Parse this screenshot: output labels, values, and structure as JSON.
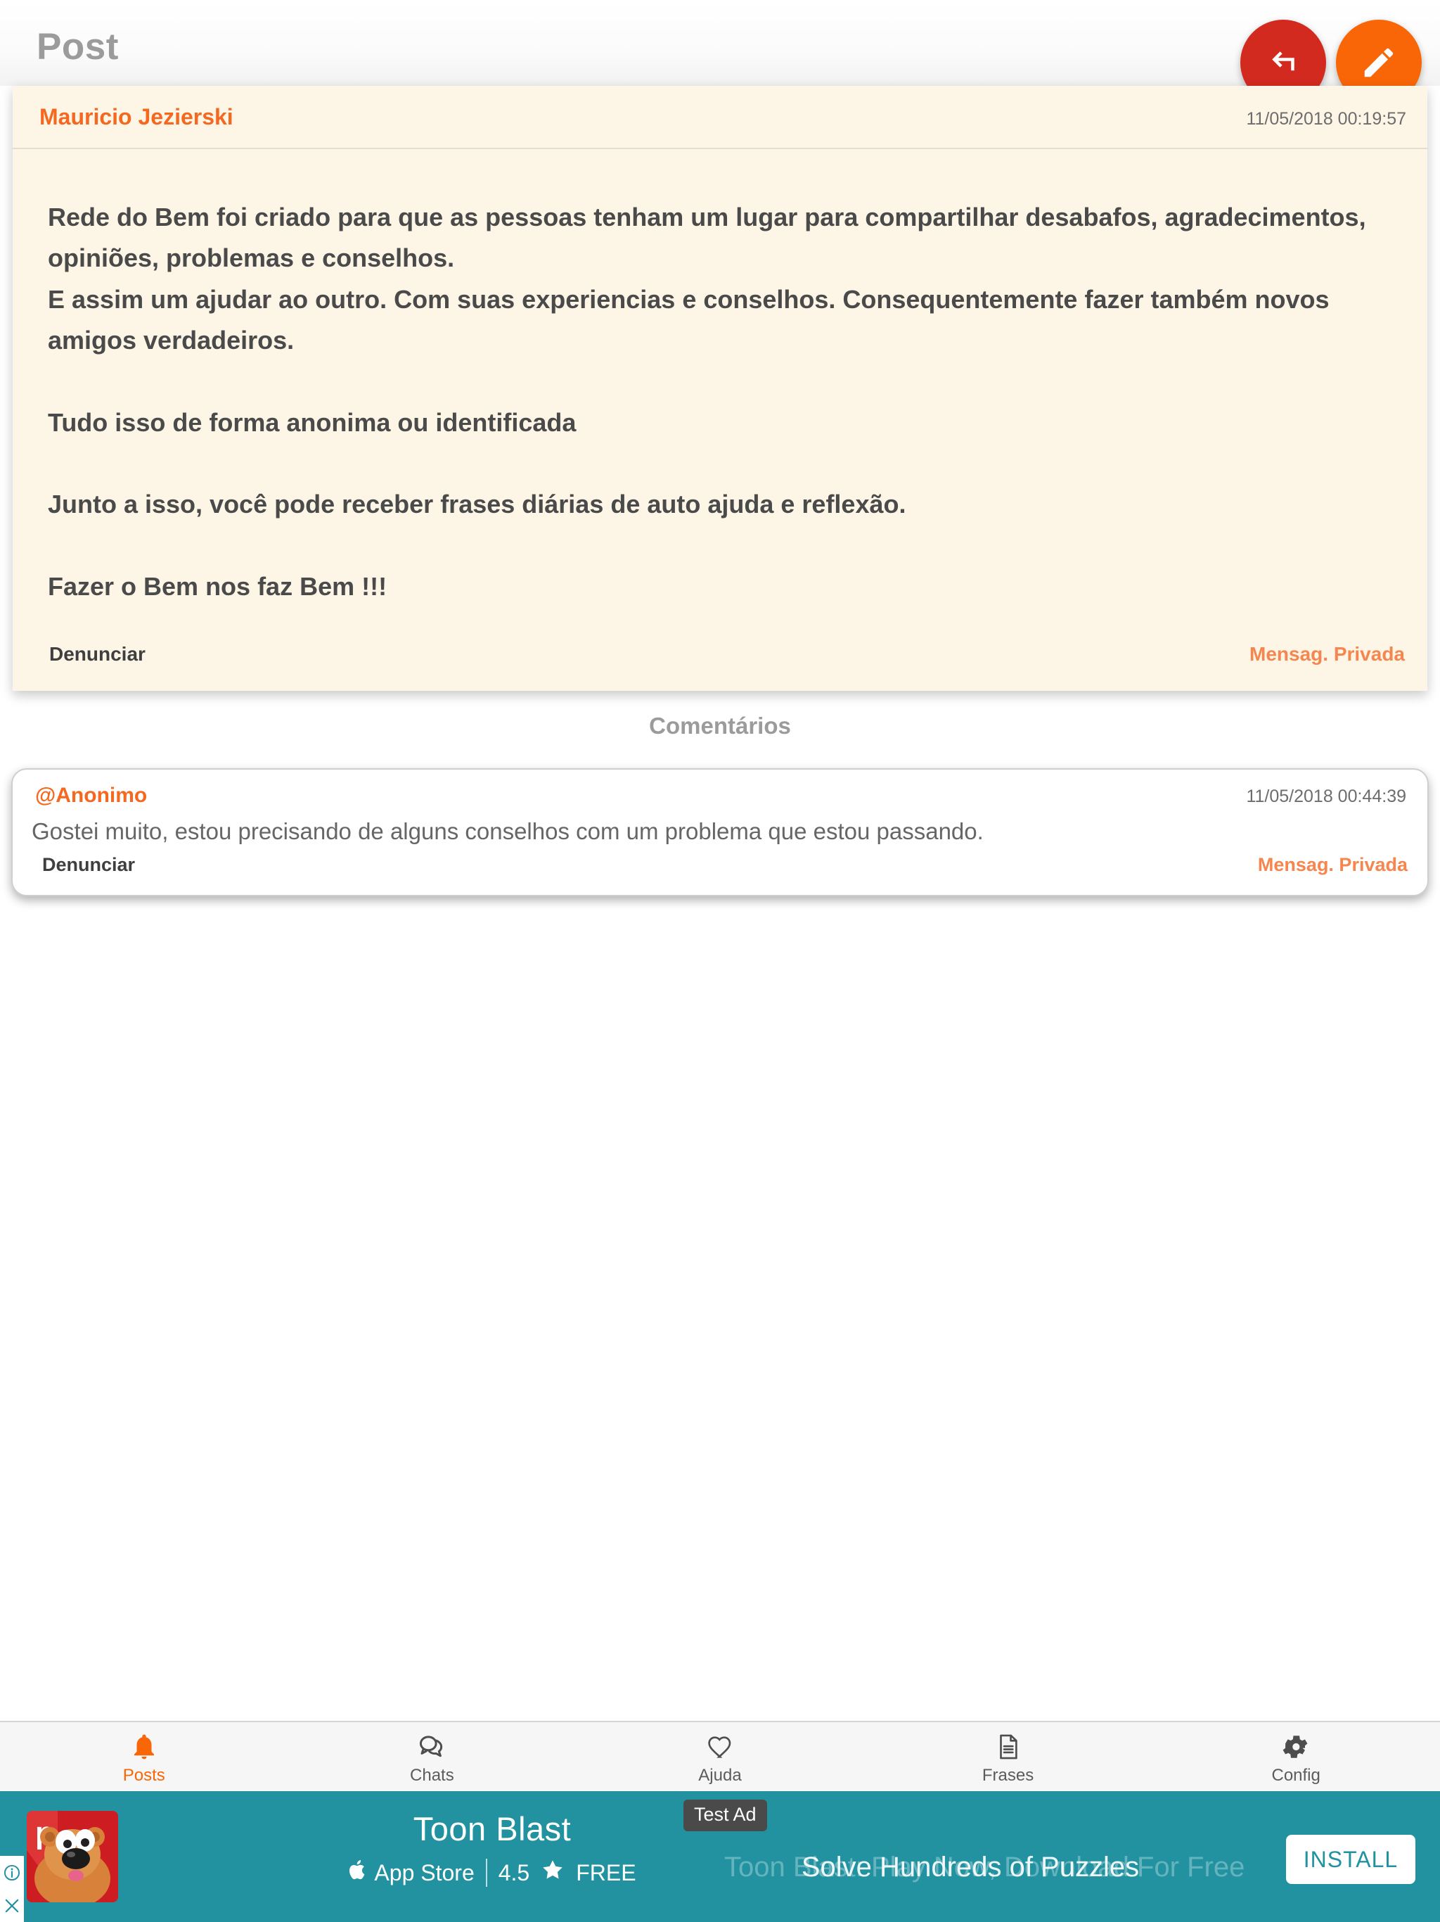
{
  "header": {
    "title": "Post",
    "back_button": "back-arrow-icon",
    "edit_button": "pencil-icon"
  },
  "post": {
    "author": "Mauricio Jezierski",
    "timestamp": "11/05/2018 00:19:57",
    "body": "Rede do Bem foi criado para que as pessoas tenham um lugar para compartilhar desabafos, agradecimentos, opiniões, problemas e conselhos.\nE assim um ajudar ao outro. Com suas experiencias e conselhos. Consequentemente fazer também novos amigos verdadeiros.\n\nTudo isso de forma anonima ou identificada\n\nJunto a isso, você pode receber frases diárias de auto ajuda e reflexão.\n\nFazer o Bem nos faz Bem !!!",
    "report_label": "Denunciar",
    "private_message_label": "Mensag. Privada"
  },
  "comments_section": {
    "heading": "Comentários",
    "items": [
      {
        "author": "@Anonimo",
        "timestamp": "11/05/2018 00:44:39",
        "text": "Gostei muito, estou precisando de alguns conselhos com um problema que estou passando.",
        "report_label": "Denunciar",
        "private_message_label": "Mensag. Privada"
      }
    ]
  },
  "tabbar": {
    "items": [
      {
        "label": "Posts",
        "icon": "bell-icon",
        "active": true
      },
      {
        "label": "Chats",
        "icon": "chat-bubbles-icon",
        "active": false
      },
      {
        "label": "Ajuda",
        "icon": "heart-icon",
        "active": false
      },
      {
        "label": "Frases",
        "icon": "document-icon",
        "active": false
      },
      {
        "label": "Config",
        "icon": "gear-icon",
        "active": false
      }
    ]
  },
  "ad": {
    "badge": "Test Ad",
    "title": "Toon Blast",
    "store": "App Store",
    "rating": "4.5",
    "price": "FREE",
    "tagline_outgoing": "Toon Blast: Play Now, Download For Free",
    "tagline_incoming": "Solve Hundreds of Puzzles",
    "install_label": "INSTALL",
    "info_icon": "info-icon",
    "close_icon": "close-icon",
    "background_color": "#2292a1"
  },
  "colors": {
    "accent_orange": "#f4681f",
    "fab_red": "#d32a20",
    "fab_orange": "#f96607",
    "post_card_bg": "#fdf6e7",
    "ad_teal": "#2292a1"
  }
}
